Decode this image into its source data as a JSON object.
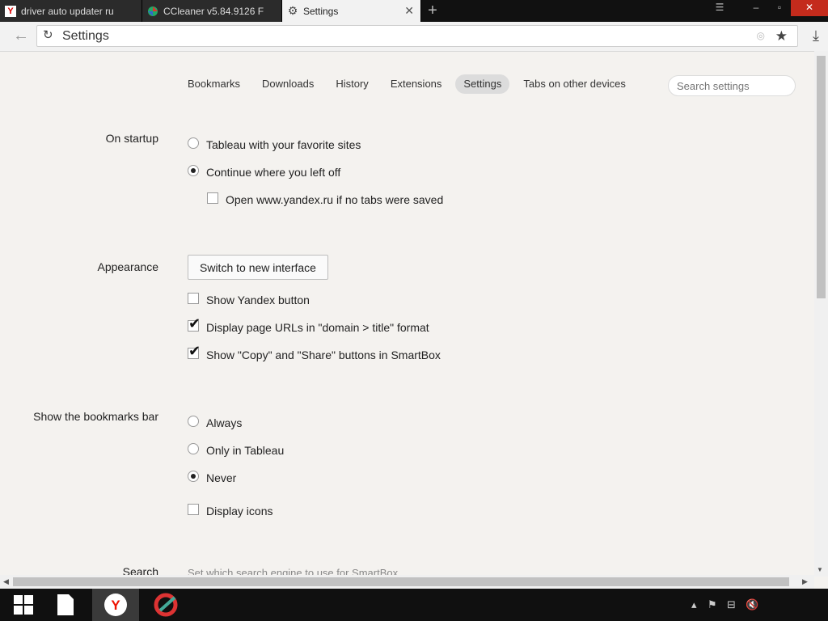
{
  "browser": {
    "tabs": [
      {
        "title": "driver auto updater ru",
        "icon": "yandex-icon"
      },
      {
        "title": "CCleaner v5.84.9126 F",
        "icon": "ccleaner-icon"
      },
      {
        "title": "Settings",
        "icon": "gear-icon",
        "active": true
      }
    ],
    "address": "Settings"
  },
  "nav": {
    "tabs": [
      "Bookmarks",
      "Downloads",
      "History",
      "Extensions",
      "Settings",
      "Tabs on other devices"
    ],
    "active": "Settings",
    "search_placeholder": "Search settings"
  },
  "startup": {
    "label": "On startup",
    "options": [
      "Tableau with your favorite sites",
      "Continue where you left off"
    ],
    "selected": "Continue where you left off",
    "checkbox_label": "Open www.yandex.ru if no tabs were saved",
    "checkbox_checked": false
  },
  "appearance": {
    "label": "Appearance",
    "button_label": "Switch to new interface",
    "checkboxes": [
      {
        "label": "Show Yandex button",
        "checked": false
      },
      {
        "label": "Display page URLs in \"domain > title\" format",
        "checked": true
      },
      {
        "label": "Show \"Copy\" and \"Share\" buttons in SmartBox",
        "checked": true
      }
    ]
  },
  "bookmarks_bar": {
    "label": "Show the bookmarks bar",
    "options": [
      "Always",
      "Only in Tableau",
      "Never"
    ],
    "selected": "Never",
    "checkbox_label": "Display icons",
    "checkbox_checked": false
  },
  "search": {
    "label": "Search",
    "description": "Set which search engine to use for SmartBox"
  },
  "colors": {
    "background": "#f4f2ef",
    "taskbar": "#101010",
    "close_button": "#c42b1c"
  }
}
